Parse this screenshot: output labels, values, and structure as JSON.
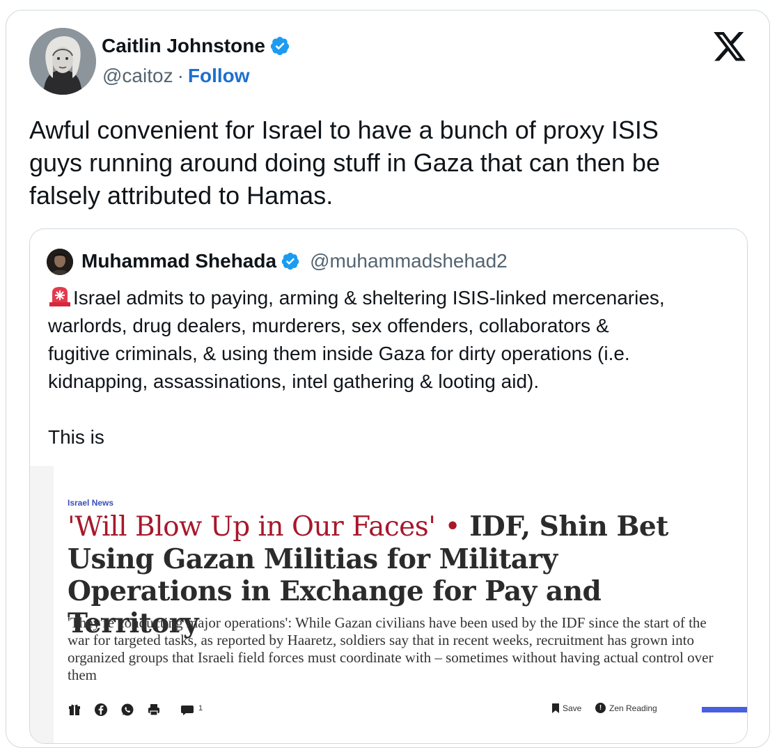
{
  "tweet": {
    "author_name": "Caitlin Johnstone",
    "author_handle": "@caitoz",
    "separator": "·",
    "follow_label": "Follow",
    "text": "Awful convenient for Israel to have a bunch of proxy ISIS\nguys running around doing stuff in Gaza that can then be\nfalsely attributed to Hamas.",
    "icons": {
      "verified": "verified-badge-icon",
      "platform": "x-logo-icon"
    },
    "colors": {
      "verified": "#1d9bf0",
      "link": "#1d6fd1",
      "secondary_text": "#536471",
      "border": "#cfd9de"
    }
  },
  "quoted_tweet": {
    "author_name": "Muhammad Shehada",
    "author_handle": "@muhammadshehad2",
    "text": "Israel admits to paying, arming & sheltering ISIS-linked mercenaries,\nwarlords, drug dealers, murderers, sex offenders, collaborators &\nfugitive criminals, & using them inside Gaza for dirty operations (i.e.\nkidnapping, assassinations, intel gathering & looting aid).",
    "text_more": "This is",
    "emoji": "rotating-light-icon",
    "article": {
      "section": "Israel News",
      "headline_kicker": "'Will Blow Up in Our Faces'",
      "headline_separator": "•",
      "headline_main": "IDF, Shin Bet Using Gazan Militias for Military Operations in Exchange for Pay and Territory",
      "dek": "'They're conducting major operations': While Gazan civilians have been used by the IDF since the start of the war for targeted tasks, as reported by Haaretz, soldiers say that in recent weeks, recruitment has grown into organized groups that Israeli field forces must coordinate with – sometimes without having actual control over them",
      "toolbar": {
        "comment_count": "1",
        "save_label": "Save",
        "zen_label": "Zen Reading",
        "zen_badge": "!",
        "icons": [
          "gift-icon",
          "facebook-icon",
          "whatsapp-icon",
          "print-icon",
          "comment-icon",
          "bookmark-icon",
          "info-icon"
        ]
      },
      "colors": {
        "kicker": "#a7182b",
        "section": "#3a4fb8",
        "accent_bar": "#4a5ee0"
      }
    }
  }
}
